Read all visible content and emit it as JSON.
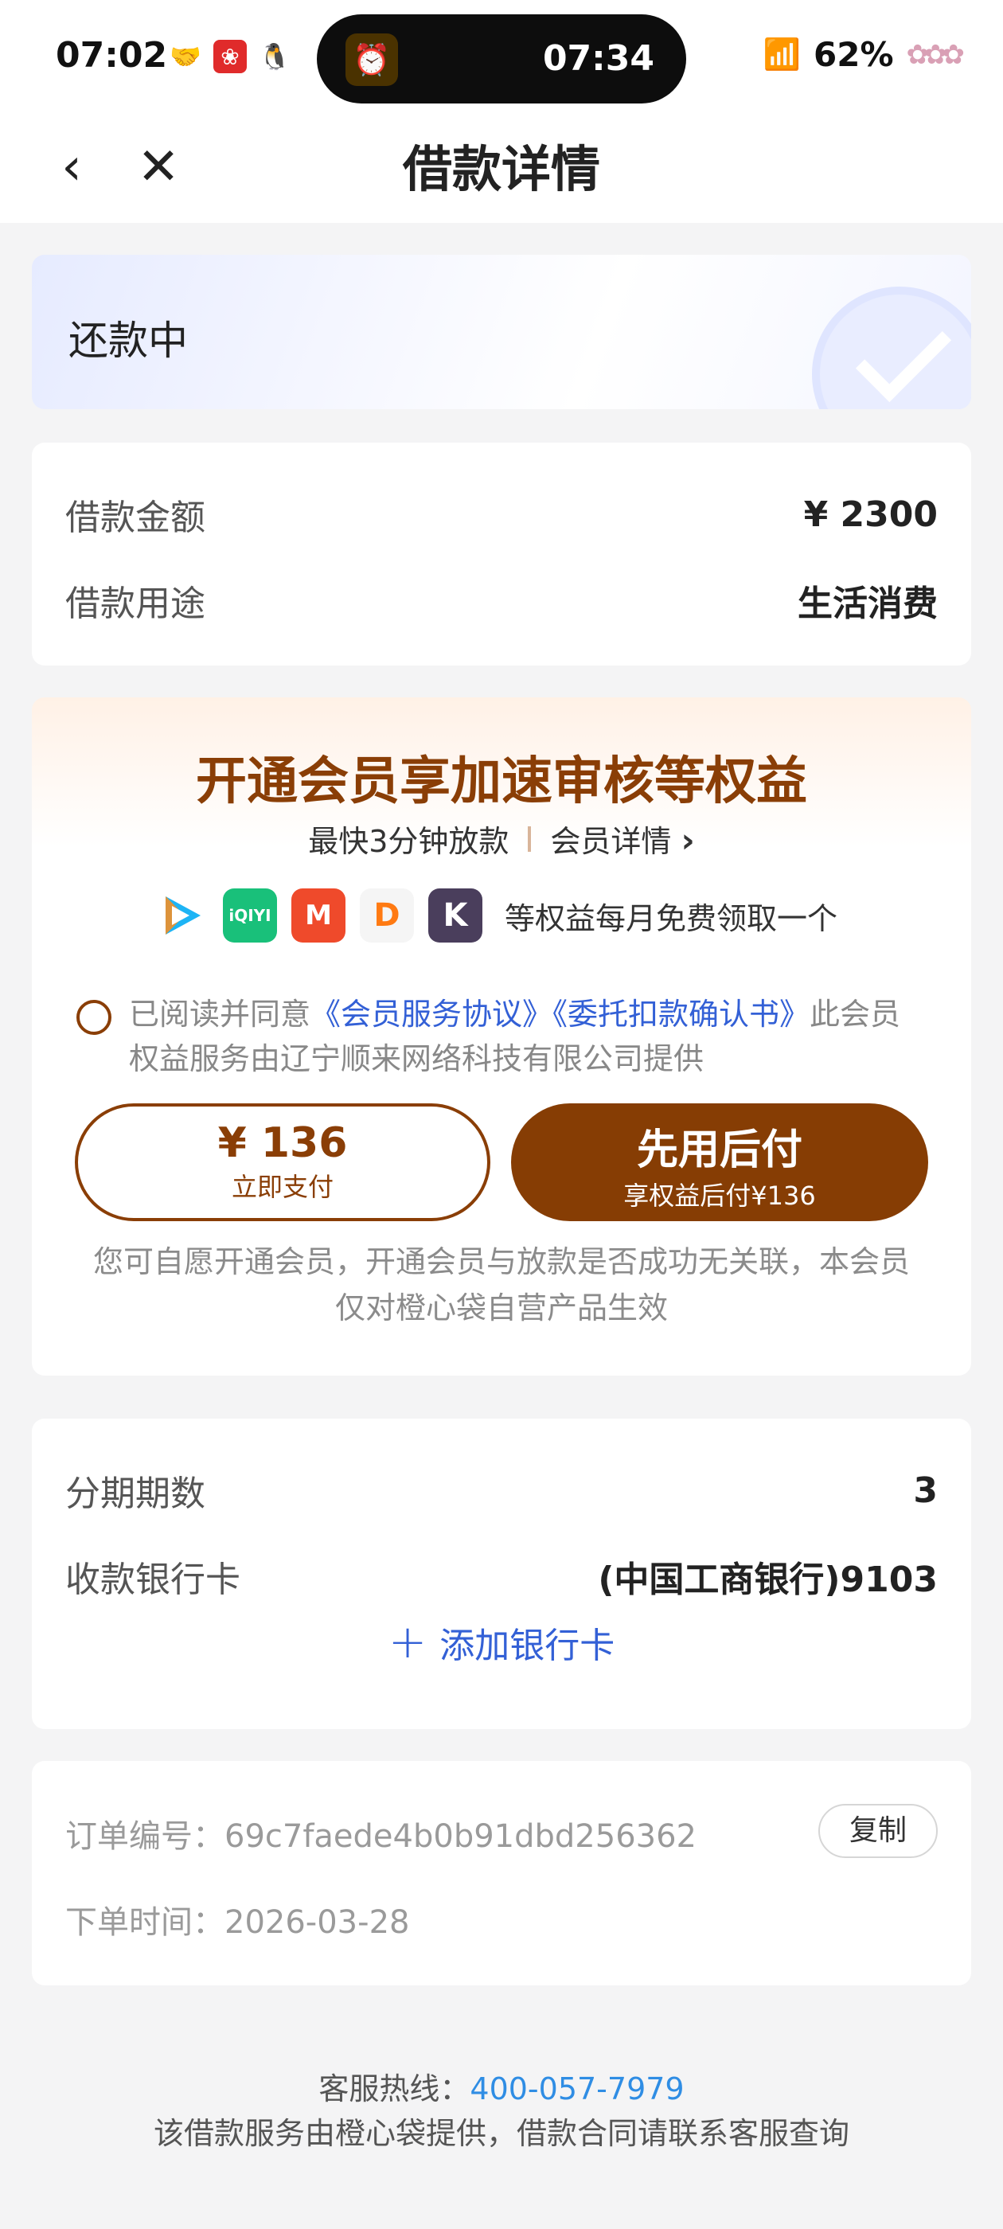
{
  "status_bar": {
    "time": "07:02",
    "island_time": "07:34",
    "battery": "62%"
  },
  "nav": {
    "title": "借款详情"
  },
  "status": {
    "label": "还款中"
  },
  "loan": {
    "amount_label": "借款金额",
    "amount_value": "¥ 2300",
    "purpose_label": "借款用途",
    "purpose_value": "生活消费"
  },
  "membership": {
    "title": "开通会员享加速审核等权益",
    "fast_loan": "最快3分钟放款",
    "details_link": "会员详情",
    "benefits_text": "等权益每月免费领取一个",
    "agree_prefix": "已阅读并同意",
    "agreement1": "《会员服务协议》",
    "agreement2": "《委托扣款确认书》",
    "agree_suffix": "此会员权益服务由辽宁顺来网络科技有限公司提供",
    "pay_price": "¥ 136",
    "pay_label": "立即支付",
    "later_title": "先用后付",
    "later_label": "享权益后付¥136",
    "note": "您可自愿开通会员，开通会员与放款是否成功无关联，本会员仅对橙心袋自营产品生效"
  },
  "installment": {
    "periods_label": "分期期数",
    "periods_value": "3",
    "bank_label": "收款银行卡",
    "bank_value": "(中国工商银行)9103",
    "add_card": "添加银行卡"
  },
  "order": {
    "number_label": "订单编号：",
    "number_value": "69c7faede4b0b91dbd256362",
    "copy": "复制",
    "time_label": "下单时间：",
    "time_value": "2026-03-28"
  },
  "footer": {
    "hotline_label": "客服热线：",
    "hotline": "400-057-7979",
    "note": "该借款服务由橙心袋提供，借款合同请联系客服查询"
  },
  "colors": {
    "brand": "#863d04",
    "link": "#3360d6",
    "tel": "#2f8de4"
  }
}
